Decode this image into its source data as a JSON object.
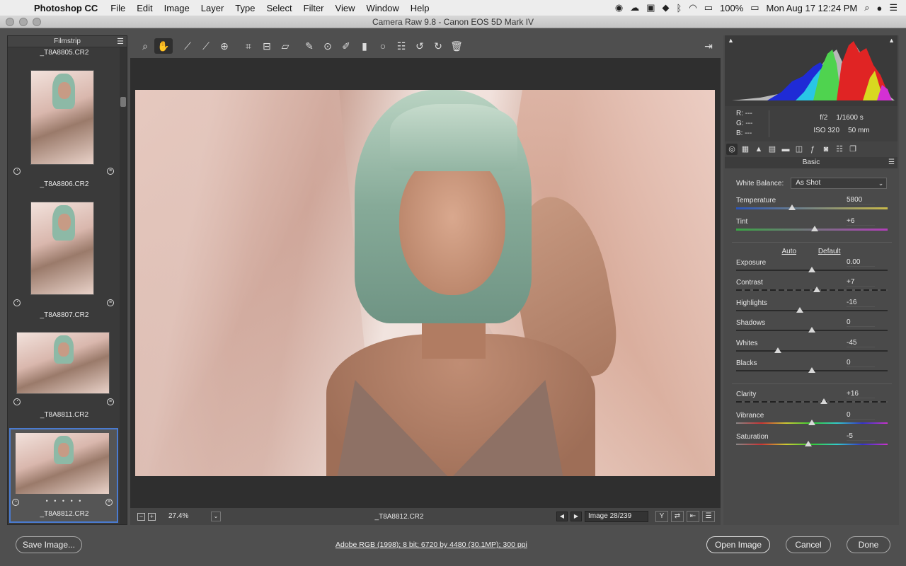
{
  "menubar": {
    "app_name": "Photoshop CC",
    "items": [
      "File",
      "Edit",
      "Image",
      "Layer",
      "Type",
      "Select",
      "Filter",
      "View",
      "Window",
      "Help"
    ],
    "battery": "100%",
    "clock": "Mon Aug 17  12:24 PM"
  },
  "window": {
    "title": "Camera Raw 9.8  -  Canon EOS 5D Mark IV"
  },
  "filmstrip": {
    "title": "Filmstrip",
    "items": [
      {
        "label": "_T8A8805.CR2"
      },
      {
        "label": "_T8A8806.CR2"
      },
      {
        "label": "_T8A8807.CR2"
      },
      {
        "label": "_T8A8811.CR2"
      },
      {
        "label": "_T8A8812.CR2",
        "selected": true
      }
    ],
    "rating_dots": "• • • • •"
  },
  "toolbar": {
    "tools": [
      "zoom-icon",
      "hand-icon",
      "white-balance-icon",
      "color-sampler-icon",
      "target-adjust-icon",
      "crop-icon",
      "straighten-icon",
      "transform-icon",
      "spot-removal-icon",
      "red-eye-icon",
      "adjustment-brush-icon",
      "graduated-filter-icon",
      "radial-filter-icon",
      "preferences-icon",
      "rotate-ccw-icon",
      "rotate-cw-icon",
      "trash-icon"
    ],
    "active_tool": "hand-icon"
  },
  "preview": {
    "zoom": "27.4%",
    "file_name": "_T8A8812.CR2",
    "image_counter": "Image 28/239"
  },
  "info": {
    "r": "R:  ---",
    "g": "G:  ---",
    "b": "B:  ---",
    "aperture": "f/2",
    "shutter": "1/1600 s",
    "iso": "ISO 320",
    "focal": "50 mm"
  },
  "basic": {
    "title": "Basic",
    "white_balance_label": "White Balance:",
    "white_balance_value": "As Shot",
    "auto": "Auto",
    "default": "Default",
    "sliders": [
      {
        "name": "Temperature",
        "value": "5800",
        "pos": 0.37
      },
      {
        "name": "Tint",
        "value": "+6",
        "pos": 0.52
      },
      {
        "name": "Exposure",
        "value": "0.00",
        "pos": 0.5
      },
      {
        "name": "Contrast",
        "value": "+7",
        "pos": 0.535
      },
      {
        "name": "Highlights",
        "value": "-16",
        "pos": 0.42
      },
      {
        "name": "Shadows",
        "value": "0",
        "pos": 0.5
      },
      {
        "name": "Whites",
        "value": "-45",
        "pos": 0.275
      },
      {
        "name": "Blacks",
        "value": "0",
        "pos": 0.5
      },
      {
        "name": "Clarity",
        "value": "+16",
        "pos": 0.58
      },
      {
        "name": "Vibrance",
        "value": "0",
        "pos": 0.5
      },
      {
        "name": "Saturation",
        "value": "-5",
        "pos": 0.475
      }
    ]
  },
  "footer": {
    "save_label": "Save Image...",
    "workflow": "Adobe RGB (1998); 8 bit; 6720 by 4480 (30.1MP); 300 ppi",
    "open_label": "Open Image",
    "cancel_label": "Cancel",
    "done_label": "Done"
  }
}
